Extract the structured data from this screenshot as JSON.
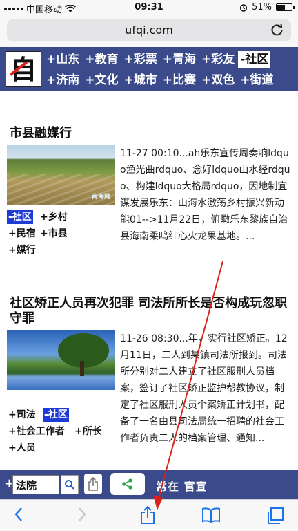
{
  "status": {
    "carrier": "中国移动",
    "time": "09:31",
    "battery": "51%"
  },
  "browser": {
    "url": "ufqi.com"
  },
  "site": {
    "logo_char": "自",
    "nav_row1": [
      "+山东",
      "+教育",
      "+彩票",
      "+青海",
      "+彩友",
      "-社区"
    ],
    "nav_row2": [
      "+济南",
      "+文化",
      "+城市",
      "+比赛",
      "+双色",
      "+街道"
    ],
    "active_nav": "-社区"
  },
  "articles": [
    {
      "title": "市县融媒行",
      "summary": "11-27 00:10...ah乐东宣传周奏响ldquo渔光曲rdquo、念好ldquo山水经rdquo、构建ldquo大格局rdquo，因地制宜谋发展乐东：山海水激荡乡村振兴新动能01-->11月22日，俯瞰乐东黎族自治县海南柔鸣红心火龙果基地。...",
      "thumb_watermark": "南海网",
      "tags": [
        "-社区",
        "+乡村",
        "+民宿",
        "+市县",
        "+媒行"
      ]
    },
    {
      "title": "社区矫正人员再次犯罪 司法所所长是否构成玩忽职守罪",
      "summary": "11-26 08:30...年，实行社区矫正。12月11日，二人到某镇司法所报到。司法所分别对二人建立了社区服刑人员档案，签订了社区矫正监护帮教协议，制定了社区服刑人员个案矫正计划书，配备了一名由县司法局统一招聘的社会工作者负责二人的档案管理、通知...",
      "tags": [
        "+司法",
        "-社区",
        "+社会工作者",
        "+所长",
        "+人员"
      ]
    }
  ],
  "pagebar": {
    "plus": "+",
    "search_value": "法院",
    "footer_text": "常在 官宣"
  },
  "icons": {
    "wifi": "wifi-icon",
    "reload": "reload-icon",
    "search": "search-icon",
    "share": "share-icon",
    "back": "back-icon",
    "forward": "forward-icon",
    "bookmarks": "bookmarks-icon",
    "tabs": "tabs-icon"
  },
  "colors": {
    "nav_bg": "#3b4a8a",
    "tag_active": "#1f3bd6",
    "ios_blue": "#1a73e8",
    "annotation_arrow": "#d9221c"
  }
}
